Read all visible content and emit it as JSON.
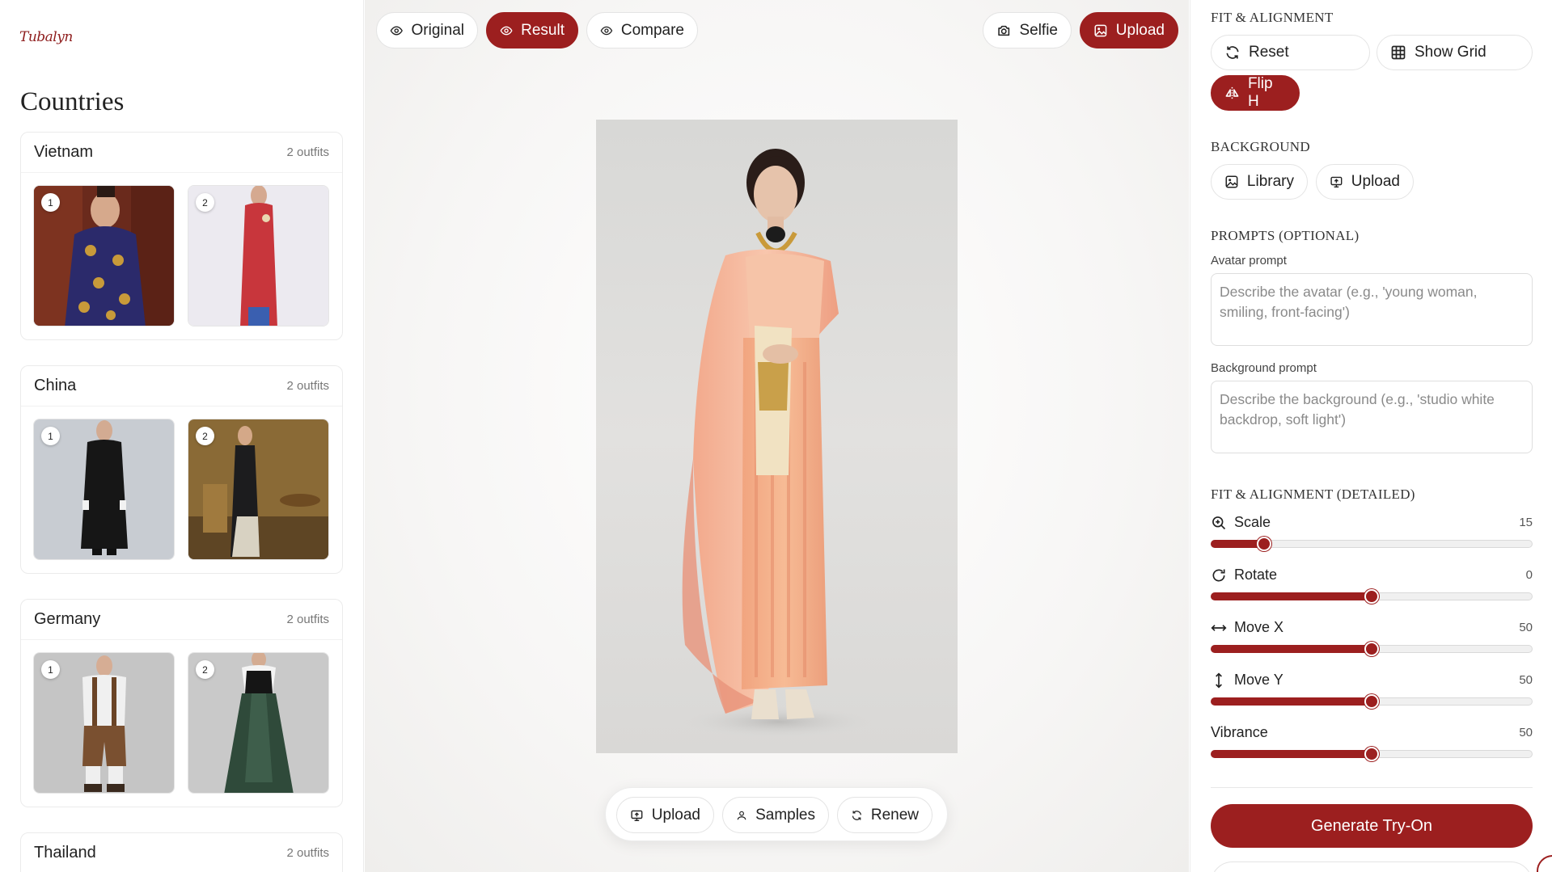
{
  "brand": {
    "logo_text": "Tubalyn"
  },
  "sidebar": {
    "title": "Countries",
    "countries": [
      {
        "name": "Vietnam",
        "count": "2 outfits",
        "outfits": [
          "1",
          "2"
        ]
      },
      {
        "name": "China",
        "count": "2 outfits",
        "outfits": [
          "1",
          "2"
        ]
      },
      {
        "name": "Germany",
        "count": "2 outfits",
        "outfits": [
          "1",
          "2"
        ]
      },
      {
        "name": "Thailand",
        "count": "2 outfits"
      }
    ]
  },
  "view_toggle": {
    "original": "Original",
    "result": "Result",
    "compare": "Compare",
    "active": "result"
  },
  "top_actions": {
    "selfie": "Selfie",
    "upload": "Upload"
  },
  "bottom_toolbar": {
    "upload": "Upload",
    "samples": "Samples",
    "renew": "Renew"
  },
  "panel": {
    "fit_title": "FIT & ALIGNMENT",
    "reset": "Reset",
    "show_grid": "Show Grid",
    "flip_h": "Flip H",
    "background_title": "BACKGROUND",
    "library": "Library",
    "bg_upload": "Upload",
    "prompts_title": "PROMPTS (OPTIONAL)",
    "avatar_label": "Avatar prompt",
    "avatar_placeholder": "Describe the avatar (e.g., 'young woman, smiling, front-facing')",
    "background_label": "Background prompt",
    "background_placeholder": "Describe the background (e.g., 'studio white backdrop, soft light')",
    "detailed_title": "FIT & ALIGNMENT (DETAILED)",
    "sliders": [
      {
        "label": "Scale",
        "value": "15",
        "fraction": 0.165,
        "icon": "zoom-in-icon"
      },
      {
        "label": "Rotate",
        "value": "0",
        "fraction": 0.5,
        "icon": "rotate-icon"
      },
      {
        "label": "Move X",
        "value": "50",
        "fraction": 0.5,
        "icon": "move-horizontal-icon"
      },
      {
        "label": "Move Y",
        "value": "50",
        "fraction": 0.5,
        "icon": "move-vertical-icon"
      },
      {
        "label": "Vibrance",
        "value": "50",
        "fraction": 0.5,
        "icon": ""
      }
    ],
    "generate": "Generate Try-On"
  },
  "colors": {
    "accent": "#9c1f1f",
    "border": "#e4e4e4"
  }
}
